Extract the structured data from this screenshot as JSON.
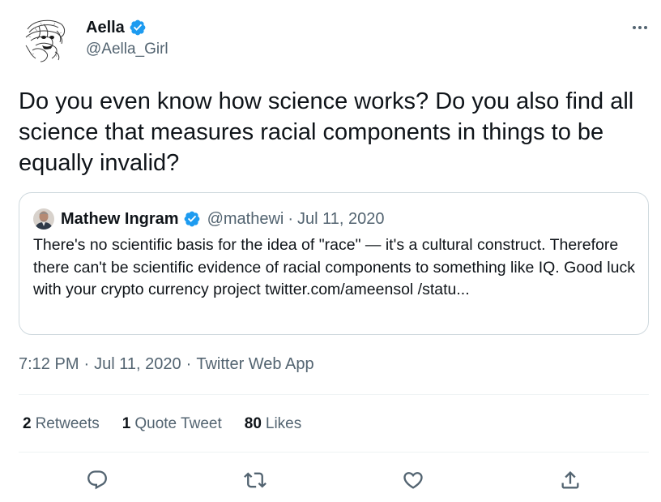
{
  "author": {
    "name": "Aella",
    "handle": "@Aella_Girl",
    "avatar_icon": "sketch-portrait-avatar",
    "verified_icon": "verified-badge-icon"
  },
  "tweet": {
    "text": "Do you even know how science works? Do you also find all science that measures racial components in things to be equally invalid?"
  },
  "quoted_tweet": {
    "author_name": "Mathew Ingram",
    "author_handle": "@mathewi",
    "separator": "·",
    "date": "Jul 11, 2020",
    "text": "There's no scientific basis for the idea of \"race\" — it's a cultural construct. Therefore there can't be scientific evidence of racial components to something like IQ. Good luck with your crypto currency project twitter.com/ameensol /statu..."
  },
  "meta": {
    "time": "7:12 PM",
    "separator": "·",
    "date": "Jul 11, 2020",
    "source": "Twitter Web App"
  },
  "stats": {
    "retweets_count": "2",
    "retweets_label": "Retweets",
    "quotes_count": "1",
    "quotes_label": "Quote Tweet",
    "likes_count": "80",
    "likes_label": "Likes"
  },
  "actions": [
    "reply-icon",
    "retweet-icon",
    "like-icon",
    "share-icon"
  ],
  "colors": {
    "text_primary": "#0f1419",
    "text_secondary": "#536471",
    "verified_blue": "#1d9bf0",
    "border": "#cfd9de",
    "divider": "#eff3f4"
  }
}
